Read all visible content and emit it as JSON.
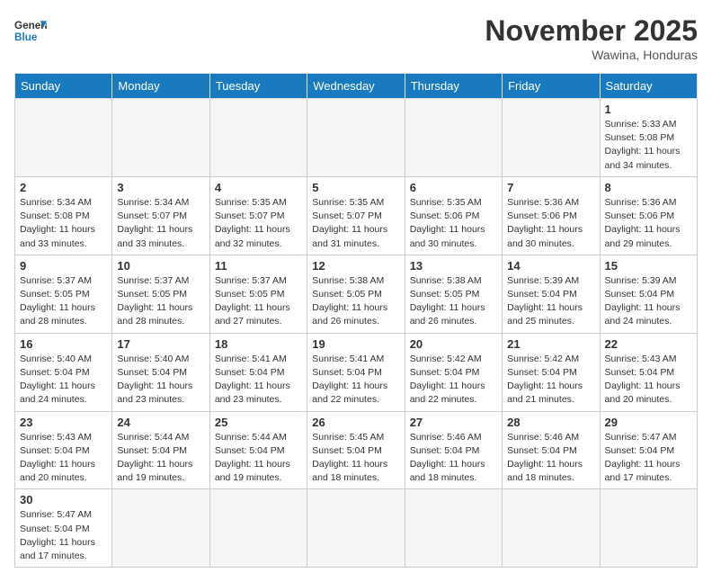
{
  "header": {
    "logo_general": "General",
    "logo_blue": "Blue",
    "month_title": "November 2025",
    "location": "Wawina, Honduras"
  },
  "days_of_week": [
    "Sunday",
    "Monday",
    "Tuesday",
    "Wednesday",
    "Thursday",
    "Friday",
    "Saturday"
  ],
  "weeks": [
    [
      {
        "day": "",
        "info": ""
      },
      {
        "day": "",
        "info": ""
      },
      {
        "day": "",
        "info": ""
      },
      {
        "day": "",
        "info": ""
      },
      {
        "day": "",
        "info": ""
      },
      {
        "day": "",
        "info": ""
      },
      {
        "day": "1",
        "info": "Sunrise: 5:33 AM\nSunset: 5:08 PM\nDaylight: 11 hours\nand 34 minutes."
      }
    ],
    [
      {
        "day": "2",
        "info": "Sunrise: 5:34 AM\nSunset: 5:08 PM\nDaylight: 11 hours\nand 33 minutes."
      },
      {
        "day": "3",
        "info": "Sunrise: 5:34 AM\nSunset: 5:07 PM\nDaylight: 11 hours\nand 33 minutes."
      },
      {
        "day": "4",
        "info": "Sunrise: 5:35 AM\nSunset: 5:07 PM\nDaylight: 11 hours\nand 32 minutes."
      },
      {
        "day": "5",
        "info": "Sunrise: 5:35 AM\nSunset: 5:07 PM\nDaylight: 11 hours\nand 31 minutes."
      },
      {
        "day": "6",
        "info": "Sunrise: 5:35 AM\nSunset: 5:06 PM\nDaylight: 11 hours\nand 30 minutes."
      },
      {
        "day": "7",
        "info": "Sunrise: 5:36 AM\nSunset: 5:06 PM\nDaylight: 11 hours\nand 30 minutes."
      },
      {
        "day": "8",
        "info": "Sunrise: 5:36 AM\nSunset: 5:06 PM\nDaylight: 11 hours\nand 29 minutes."
      }
    ],
    [
      {
        "day": "9",
        "info": "Sunrise: 5:37 AM\nSunset: 5:05 PM\nDaylight: 11 hours\nand 28 minutes."
      },
      {
        "day": "10",
        "info": "Sunrise: 5:37 AM\nSunset: 5:05 PM\nDaylight: 11 hours\nand 28 minutes."
      },
      {
        "day": "11",
        "info": "Sunrise: 5:37 AM\nSunset: 5:05 PM\nDaylight: 11 hours\nand 27 minutes."
      },
      {
        "day": "12",
        "info": "Sunrise: 5:38 AM\nSunset: 5:05 PM\nDaylight: 11 hours\nand 26 minutes."
      },
      {
        "day": "13",
        "info": "Sunrise: 5:38 AM\nSunset: 5:05 PM\nDaylight: 11 hours\nand 26 minutes."
      },
      {
        "day": "14",
        "info": "Sunrise: 5:39 AM\nSunset: 5:04 PM\nDaylight: 11 hours\nand 25 minutes."
      },
      {
        "day": "15",
        "info": "Sunrise: 5:39 AM\nSunset: 5:04 PM\nDaylight: 11 hours\nand 24 minutes."
      }
    ],
    [
      {
        "day": "16",
        "info": "Sunrise: 5:40 AM\nSunset: 5:04 PM\nDaylight: 11 hours\nand 24 minutes."
      },
      {
        "day": "17",
        "info": "Sunrise: 5:40 AM\nSunset: 5:04 PM\nDaylight: 11 hours\nand 23 minutes."
      },
      {
        "day": "18",
        "info": "Sunrise: 5:41 AM\nSunset: 5:04 PM\nDaylight: 11 hours\nand 23 minutes."
      },
      {
        "day": "19",
        "info": "Sunrise: 5:41 AM\nSunset: 5:04 PM\nDaylight: 11 hours\nand 22 minutes."
      },
      {
        "day": "20",
        "info": "Sunrise: 5:42 AM\nSunset: 5:04 PM\nDaylight: 11 hours\nand 22 minutes."
      },
      {
        "day": "21",
        "info": "Sunrise: 5:42 AM\nSunset: 5:04 PM\nDaylight: 11 hours\nand 21 minutes."
      },
      {
        "day": "22",
        "info": "Sunrise: 5:43 AM\nSunset: 5:04 PM\nDaylight: 11 hours\nand 20 minutes."
      }
    ],
    [
      {
        "day": "23",
        "info": "Sunrise: 5:43 AM\nSunset: 5:04 PM\nDaylight: 11 hours\nand 20 minutes."
      },
      {
        "day": "24",
        "info": "Sunrise: 5:44 AM\nSunset: 5:04 PM\nDaylight: 11 hours\nand 19 minutes."
      },
      {
        "day": "25",
        "info": "Sunrise: 5:44 AM\nSunset: 5:04 PM\nDaylight: 11 hours\nand 19 minutes."
      },
      {
        "day": "26",
        "info": "Sunrise: 5:45 AM\nSunset: 5:04 PM\nDaylight: 11 hours\nand 18 minutes."
      },
      {
        "day": "27",
        "info": "Sunrise: 5:46 AM\nSunset: 5:04 PM\nDaylight: 11 hours\nand 18 minutes."
      },
      {
        "day": "28",
        "info": "Sunrise: 5:46 AM\nSunset: 5:04 PM\nDaylight: 11 hours\nand 18 minutes."
      },
      {
        "day": "29",
        "info": "Sunrise: 5:47 AM\nSunset: 5:04 PM\nDaylight: 11 hours\nand 17 minutes."
      }
    ],
    [
      {
        "day": "30",
        "info": "Sunrise: 5:47 AM\nSunset: 5:04 PM\nDaylight: 11 hours\nand 17 minutes."
      },
      {
        "day": "",
        "info": ""
      },
      {
        "day": "",
        "info": ""
      },
      {
        "day": "",
        "info": ""
      },
      {
        "day": "",
        "info": ""
      },
      {
        "day": "",
        "info": ""
      },
      {
        "day": "",
        "info": ""
      }
    ]
  ]
}
